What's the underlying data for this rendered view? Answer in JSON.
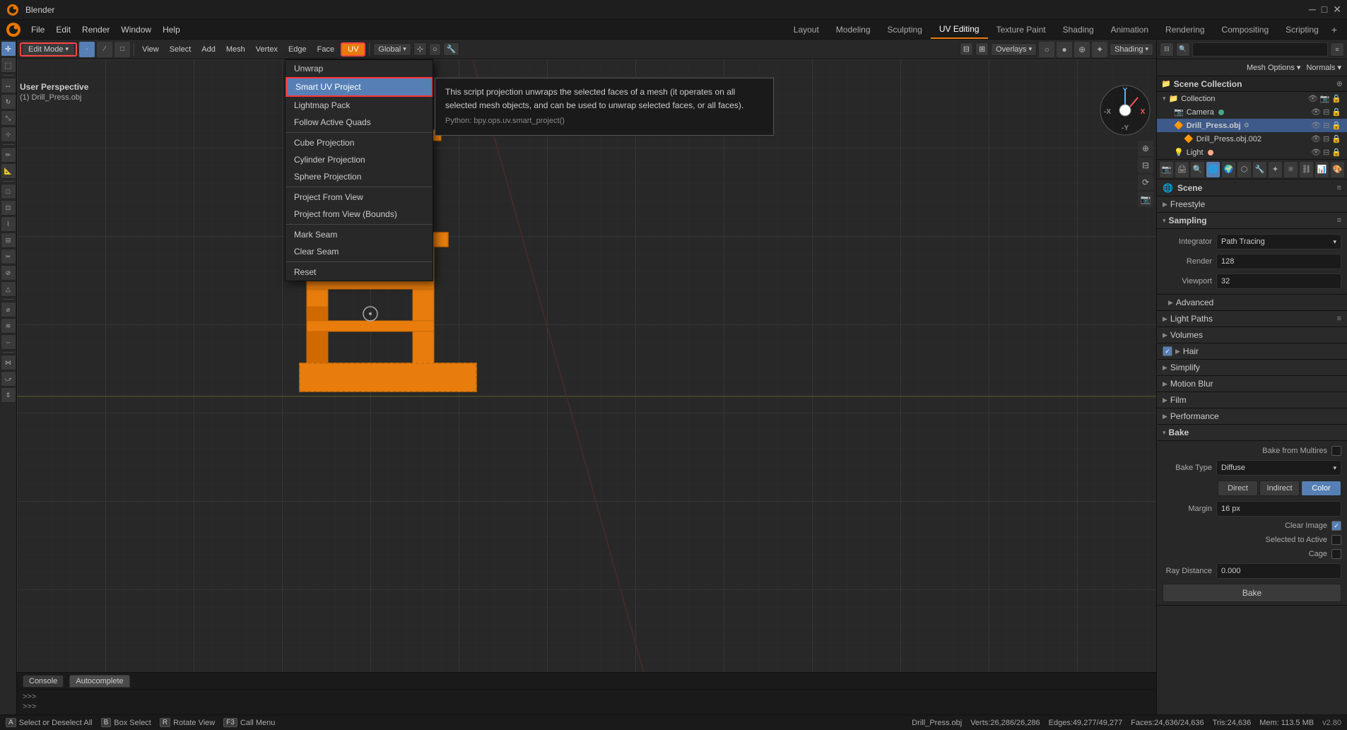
{
  "app": {
    "title": "Blender"
  },
  "top_menu": {
    "items": [
      "File",
      "Edit",
      "Render",
      "Window",
      "Help"
    ]
  },
  "workspace_tabs": {
    "items": [
      "Layout",
      "Modeling",
      "Sculpting",
      "UV Editing",
      "Texture Paint",
      "Shading",
      "Animation",
      "Rendering",
      "Compositing",
      "Scripting"
    ],
    "active": "UV Editing"
  },
  "viewport_header": {
    "mode": "Edit Mode",
    "mode_dropdown": true,
    "menu_items": [
      "View",
      "Select",
      "Add",
      "Mesh",
      "Vertex",
      "Edge",
      "Face",
      "UV"
    ],
    "uv_active": true,
    "transform": "Global",
    "overlays_label": "Overlays",
    "shading_label": "Shading"
  },
  "uv_menu": {
    "items": [
      {
        "label": "Unwrap",
        "id": "unwrap"
      },
      {
        "label": "Smart UV Project",
        "id": "smart-uv",
        "highlighted": true
      },
      {
        "label": "Lightmap Pack",
        "id": "lightmap"
      },
      {
        "label": "Follow Active Quads",
        "id": "follow-active"
      },
      {
        "label": "",
        "separator": true
      },
      {
        "label": "Cube Projection",
        "id": "cube"
      },
      {
        "label": "Cylinder Projection",
        "id": "cylinder"
      },
      {
        "label": "Sphere Projection",
        "id": "sphere"
      },
      {
        "label": "",
        "separator": true
      },
      {
        "label": "Project From View",
        "id": "proj-view"
      },
      {
        "label": "Project from View (Bounds)",
        "id": "proj-view-bounds"
      },
      {
        "label": "",
        "separator": true
      },
      {
        "label": "Mark Seam",
        "id": "mark-seam"
      },
      {
        "label": "Clear Seam",
        "id": "clear-seam"
      },
      {
        "label": "",
        "separator": true
      },
      {
        "label": "Reset",
        "id": "reset"
      }
    ]
  },
  "tooltip": {
    "title": "Smart UV Project",
    "description": "This script projection unwraps the selected faces of a mesh (it operates on all selected mesh objects, and can be used to unwrap selected faces, or all faces).",
    "python": "bpy.ops.uv.smart_project()"
  },
  "scene_tree": {
    "title": "Scene Collection",
    "items": [
      {
        "label": "Scene Collection",
        "icon": "📁",
        "indent": 0,
        "expanded": true
      },
      {
        "label": "Collection",
        "icon": "📁",
        "indent": 1,
        "expanded": true
      },
      {
        "label": "Camera",
        "icon": "📷",
        "indent": 2,
        "active": false
      },
      {
        "label": "Drill_Press.obj",
        "icon": "🔶",
        "indent": 2,
        "active": true,
        "highlighted": true
      },
      {
        "label": "Drill_Press.obj.002",
        "icon": "🔶",
        "indent": 3,
        "active": false
      },
      {
        "label": "Light",
        "icon": "💡",
        "indent": 2,
        "active": false
      }
    ]
  },
  "properties_panel": {
    "scene_name": "Scene",
    "sections": [
      {
        "label": "Freestyle",
        "expanded": false
      },
      {
        "label": "Sampling",
        "expanded": true
      },
      {
        "label": "Advanced",
        "expanded": false
      },
      {
        "label": "Light Paths",
        "expanded": false
      },
      {
        "label": "Volumes",
        "expanded": false
      },
      {
        "label": "Hair",
        "expanded": false,
        "checked": true
      },
      {
        "label": "Simplify",
        "expanded": false
      },
      {
        "label": "Motion Blur",
        "expanded": false
      },
      {
        "label": "Film",
        "expanded": false
      },
      {
        "label": "Performance",
        "expanded": false
      },
      {
        "label": "Bake",
        "expanded": true
      }
    ],
    "sampling": {
      "integrator_label": "Integrator",
      "integrator_value": "Path Tracing",
      "render_label": "Render",
      "render_value": "128",
      "viewport_label": "Viewport",
      "viewport_value": "32"
    },
    "bake": {
      "bake_from_multires_label": "Bake from Multires",
      "bake_type_label": "Bake Type",
      "bake_type_value": "Diffuse",
      "direct_label": "Direct",
      "indirect_label": "Indirect",
      "color_label": "Color",
      "margin_label": "Margin",
      "margin_value": "16 px",
      "clear_image_label": "Clear Image",
      "clear_image_checked": true,
      "selected_to_active_label": "Selected to Active",
      "cage_label": "Cage",
      "ray_distance_label": "Ray Distance",
      "ray_distance_value": "0.000",
      "bake_button_label": "Bake"
    }
  },
  "status_bar": {
    "select_label": "Select or Deselect All",
    "box_select_label": "Box Select",
    "rotate_label": "Rotate View",
    "call_menu_label": "Call Menu",
    "object_info": "Drill_Press.obj",
    "verts": "Verts:26,286/26,286",
    "edges": "Edges:49,277/49,277",
    "faces": "Faces:24,636/24,636",
    "tris": "Tris:24,636",
    "mem": "Mem: 113.5 MB",
    "version": "v2.80"
  },
  "console_tabs": [
    "Console",
    "Autocomplete"
  ],
  "console_prompts": [
    ">>>",
    ">>>"
  ],
  "mesh_options_label": "Mesh Options ▾",
  "normals_label": "Normals ▾"
}
